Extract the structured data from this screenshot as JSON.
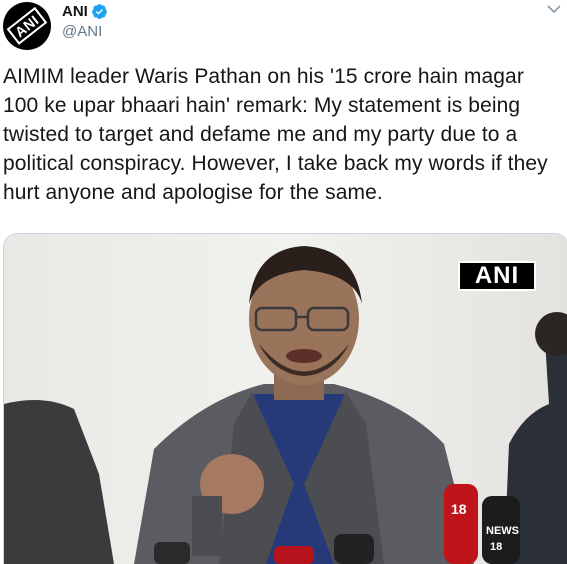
{
  "tweet": {
    "author": {
      "display_name": "ANI",
      "handle": "@ANI",
      "avatar_logo_text": "ANI",
      "verified": true
    },
    "text": "AIMIM leader Waris Pathan on his '15 crore hain magar 100 ke upar bhaari hain' remark: My statement is being twisted to target and defame me and my party due to a political conspiracy. However, I take back my words if they hurt anyone and apologise for the same.",
    "media": {
      "watermark": "ANI",
      "mic_labels": [
        "18",
        "NEWS",
        "18"
      ]
    }
  },
  "icons": {
    "verified": "verified-badge-icon",
    "menu": "chevron-down-icon"
  },
  "colors": {
    "verified_blue": "#1da1f2",
    "secondary_text": "#657786",
    "primary_text": "#14171a"
  }
}
